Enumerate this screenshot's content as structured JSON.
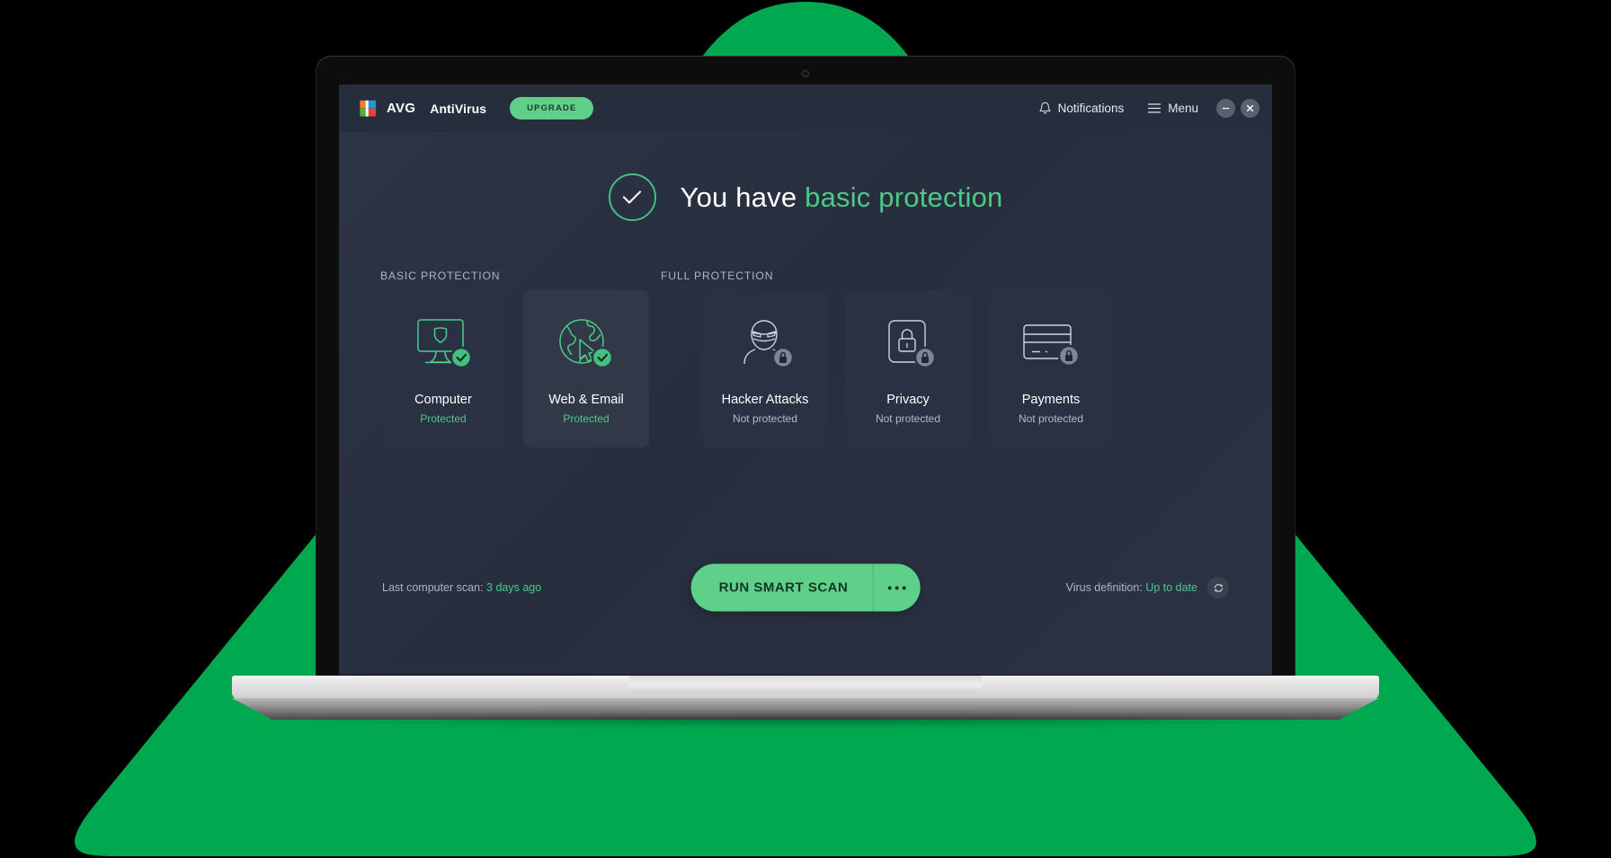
{
  "colors": {
    "brand_green": "#00a94f",
    "accent_green": "#4cca86",
    "button_green": "#5fd08a",
    "app_bg": "#2b3244",
    "header_bg": "#262d3c",
    "card_bg": "#2a3143",
    "card_bg_highlight": "#313949"
  },
  "header": {
    "logo_name": "avg-logo",
    "brand": "AVG",
    "product": "AntiVirus",
    "upgrade_label": "UPGRADE",
    "notifications_label": "Notifications",
    "notifications_icon": "bell-icon",
    "menu_label": "Menu",
    "menu_icon": "hamburger-icon",
    "minimize_icon": "minimize-icon",
    "close_icon": "close-icon"
  },
  "hero": {
    "status_icon": "checkmark-circle-icon",
    "text_plain": "You have",
    "text_accent": "basic protection"
  },
  "sections": {
    "basic_label": "BASIC PROTECTION",
    "full_label": "FULL PROTECTION"
  },
  "cards": [
    {
      "title": "Computer",
      "status": "Protected",
      "protected": true,
      "icon": "monitor-shield-icon",
      "badge": "check-badge-icon",
      "group": "basic"
    },
    {
      "title": "Web & Email",
      "status": "Protected",
      "protected": true,
      "icon": "globe-cursor-icon",
      "badge": "check-badge-icon",
      "group": "basic",
      "highlighted": true
    },
    {
      "title": "Hacker Attacks",
      "status": "Not protected",
      "protected": false,
      "icon": "masked-hacker-icon",
      "badge": "lock-badge-icon",
      "group": "full"
    },
    {
      "title": "Privacy",
      "status": "Not protected",
      "protected": false,
      "icon": "padlock-square-icon",
      "badge": "lock-badge-icon",
      "group": "full"
    },
    {
      "title": "Payments",
      "status": "Not protected",
      "protected": false,
      "icon": "credit-card-icon",
      "badge": "lock-badge-icon",
      "group": "full"
    }
  ],
  "footer": {
    "last_scan_label": "Last computer scan:",
    "last_scan_value": "3 days ago",
    "scan_button_label": "RUN SMART SCAN",
    "scan_more_icon": "ellipsis-icon",
    "virus_def_label": "Virus definition:",
    "virus_def_value": "Up to date",
    "refresh_icon": "refresh-icon"
  }
}
